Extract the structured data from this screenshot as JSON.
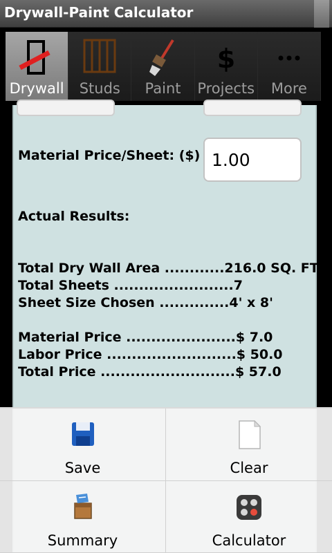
{
  "app": {
    "title": "Drywall-Paint Calculator"
  },
  "tabs": [
    {
      "label": "Drywall",
      "icon": "drywall-icon",
      "active": true
    },
    {
      "label": "Studs",
      "icon": "studs-icon",
      "active": false
    },
    {
      "label": "Paint",
      "icon": "paintbrush-icon",
      "active": false
    },
    {
      "label": "Projects",
      "icon": "dollar-icon",
      "active": false
    },
    {
      "label": "More",
      "icon": "more-icon",
      "active": false
    }
  ],
  "form": {
    "material_price_label": "Material Price/Sheet: ($)",
    "material_price_value": "1.00"
  },
  "results": {
    "heading": "Actual Results:",
    "lines": [
      "Total Dry Wall Area ............216.0 SQ. FT",
      "Total Sheets ........................7",
      "Sheet Size Chosen ..............4' x 8'",
      "Material Price ......................$ 7.0",
      "Labor Price ..........................$ 50.0",
      "Total Price ...........................$ 57.0"
    ]
  },
  "menu": {
    "items": [
      {
        "label": "Save",
        "icon": "save-icon"
      },
      {
        "label": "Clear",
        "icon": "clear-icon"
      },
      {
        "label": "Summary",
        "icon": "summary-icon"
      },
      {
        "label": "Calculator",
        "icon": "calculator-icon"
      }
    ]
  },
  "colors": {
    "content_bg": "#cfe1e1",
    "tab_active": "#8f8f8f",
    "accent_red": "#e02020"
  }
}
